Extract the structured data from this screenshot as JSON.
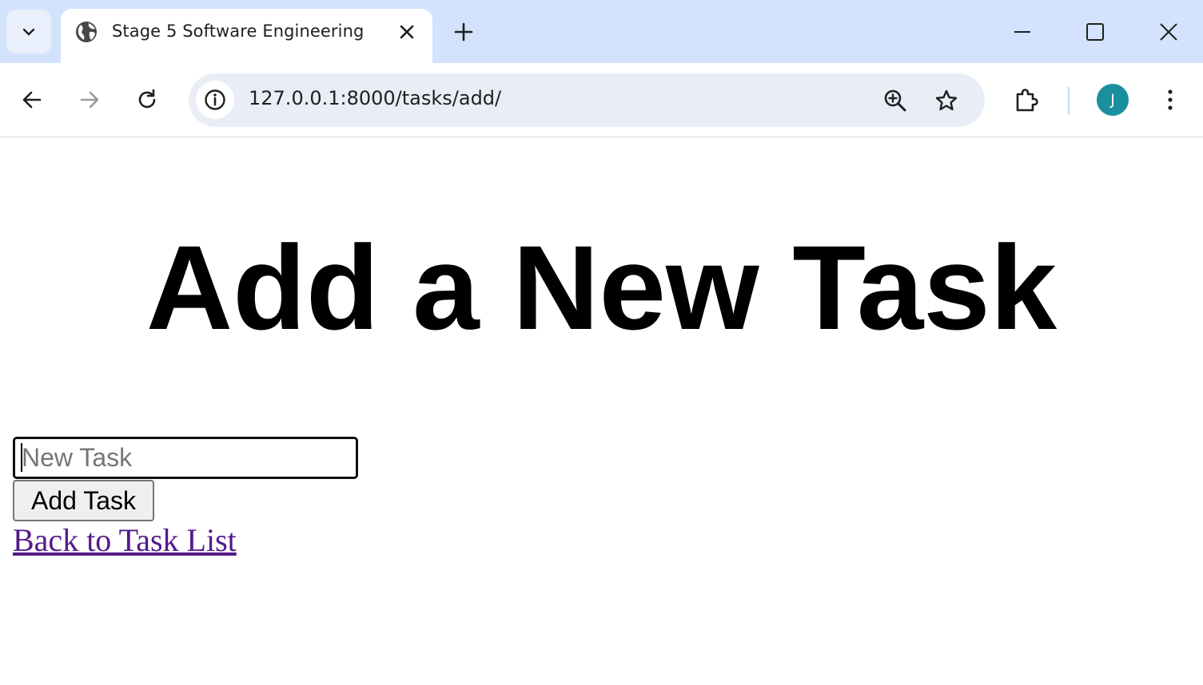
{
  "browser": {
    "tab": {
      "title": "Stage 5 Software Engineering",
      "favicon": "globe-icon"
    },
    "address_bar": {
      "url": "127.0.0.1:8000/tasks/add/"
    },
    "profile": {
      "initial": "J",
      "color": "#1a8fa0"
    },
    "colors": {
      "tabstrip": "#d3e3fd",
      "omnibox": "#e9eef6"
    }
  },
  "page": {
    "heading": "Add a New Task",
    "form": {
      "input_placeholder": "New Task",
      "input_value": "",
      "submit_label": "Add Task"
    },
    "back_link": "Back to Task List",
    "link_color": "#551a8b"
  }
}
